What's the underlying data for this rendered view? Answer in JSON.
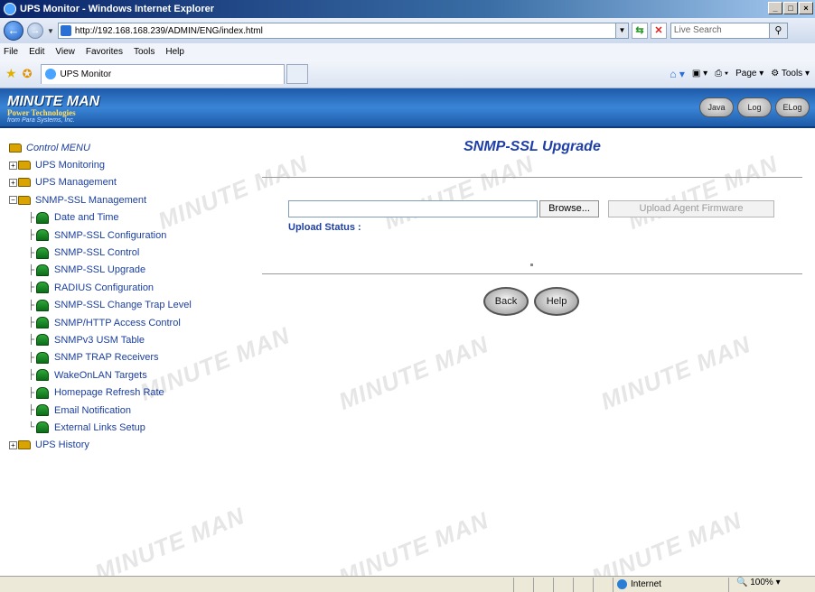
{
  "window": {
    "title": "UPS Monitor - Windows Internet Explorer",
    "buttons": [
      "_",
      "□",
      "×"
    ]
  },
  "address": {
    "url": "http://192.168.168.239/ADMIN/ENG/index.html",
    "search_placeholder": "Live Search"
  },
  "menubar": {
    "items": [
      "File",
      "Edit",
      "View",
      "Favorites",
      "Tools",
      "Help"
    ]
  },
  "tabbar": {
    "tab_label": "UPS Monitor",
    "page_menu": "Page",
    "tools_menu": "Tools"
  },
  "banner": {
    "logo_line1": "MINUTE MAN",
    "logo_line2": "Power Technologies",
    "logo_line3": "from Para Systems, Inc.",
    "buttons": [
      "Java",
      "Log",
      "ELog"
    ]
  },
  "tree": {
    "root": "Control MENU",
    "folders": {
      "ups_monitoring": "UPS Monitoring",
      "ups_management": "UPS Management",
      "snmp_ssl_management": "SNMP-SSL Management",
      "ups_history": "UPS History"
    },
    "items": [
      "Date and Time",
      "SNMP-SSL Configuration",
      "SNMP-SSL Control",
      "SNMP-SSL Upgrade",
      "RADIUS Configuration",
      "SNMP-SSL Change Trap Level",
      "SNMP/HTTP Access Control",
      "SNMPv3 USM Table",
      "SNMP TRAP Receivers",
      "WakeOnLAN Targets",
      "Homepage Refresh Rate",
      "Email Notification",
      "External Links Setup"
    ]
  },
  "main": {
    "title": "SNMP-SSL Upgrade",
    "file_value": "",
    "browse_label": "Browse...",
    "upload_label": "Upload Agent Firmware",
    "status_label": "Upload Status :",
    "back_label": "Back",
    "help_label": "Help"
  },
  "statusbar": {
    "zone": "Internet",
    "zoom": "100%"
  },
  "watermark": "MINUTE MAN",
  "colors": {
    "link": "#1b3ea0",
    "banner": "#2a6fc4",
    "title": "#1e3fa8"
  }
}
